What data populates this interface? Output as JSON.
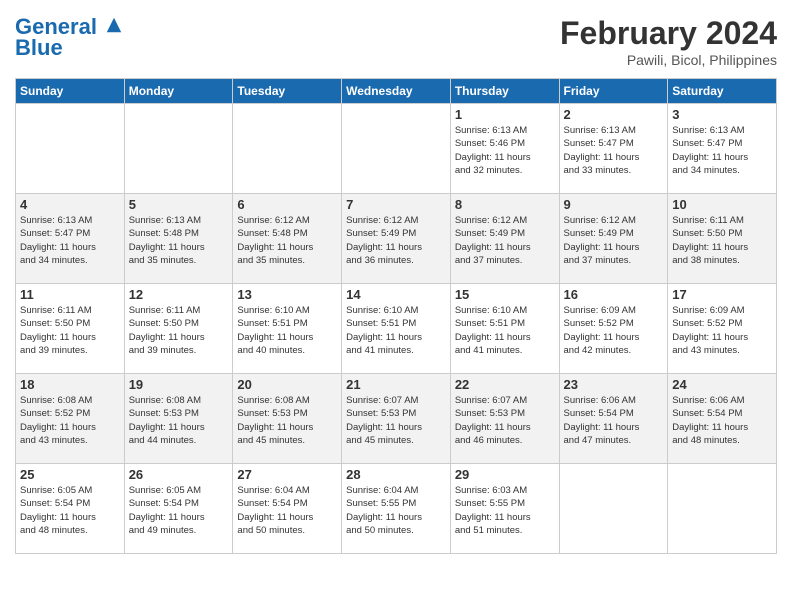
{
  "header": {
    "logo_line1": "General",
    "logo_line2": "Blue",
    "month_year": "February 2024",
    "location": "Pawili, Bicol, Philippines"
  },
  "calendar": {
    "days_of_week": [
      "Sunday",
      "Monday",
      "Tuesday",
      "Wednesday",
      "Thursday",
      "Friday",
      "Saturday"
    ],
    "weeks": [
      [
        {
          "day": "",
          "info": ""
        },
        {
          "day": "",
          "info": ""
        },
        {
          "day": "",
          "info": ""
        },
        {
          "day": "",
          "info": ""
        },
        {
          "day": "1",
          "info": "Sunrise: 6:13 AM\nSunset: 5:46 PM\nDaylight: 11 hours\nand 32 minutes."
        },
        {
          "day": "2",
          "info": "Sunrise: 6:13 AM\nSunset: 5:47 PM\nDaylight: 11 hours\nand 33 minutes."
        },
        {
          "day": "3",
          "info": "Sunrise: 6:13 AM\nSunset: 5:47 PM\nDaylight: 11 hours\nand 34 minutes."
        }
      ],
      [
        {
          "day": "4",
          "info": "Sunrise: 6:13 AM\nSunset: 5:47 PM\nDaylight: 11 hours\nand 34 minutes."
        },
        {
          "day": "5",
          "info": "Sunrise: 6:13 AM\nSunset: 5:48 PM\nDaylight: 11 hours\nand 35 minutes."
        },
        {
          "day": "6",
          "info": "Sunrise: 6:12 AM\nSunset: 5:48 PM\nDaylight: 11 hours\nand 35 minutes."
        },
        {
          "day": "7",
          "info": "Sunrise: 6:12 AM\nSunset: 5:49 PM\nDaylight: 11 hours\nand 36 minutes."
        },
        {
          "day": "8",
          "info": "Sunrise: 6:12 AM\nSunset: 5:49 PM\nDaylight: 11 hours\nand 37 minutes."
        },
        {
          "day": "9",
          "info": "Sunrise: 6:12 AM\nSunset: 5:49 PM\nDaylight: 11 hours\nand 37 minutes."
        },
        {
          "day": "10",
          "info": "Sunrise: 6:11 AM\nSunset: 5:50 PM\nDaylight: 11 hours\nand 38 minutes."
        }
      ],
      [
        {
          "day": "11",
          "info": "Sunrise: 6:11 AM\nSunset: 5:50 PM\nDaylight: 11 hours\nand 39 minutes."
        },
        {
          "day": "12",
          "info": "Sunrise: 6:11 AM\nSunset: 5:50 PM\nDaylight: 11 hours\nand 39 minutes."
        },
        {
          "day": "13",
          "info": "Sunrise: 6:10 AM\nSunset: 5:51 PM\nDaylight: 11 hours\nand 40 minutes."
        },
        {
          "day": "14",
          "info": "Sunrise: 6:10 AM\nSunset: 5:51 PM\nDaylight: 11 hours\nand 41 minutes."
        },
        {
          "day": "15",
          "info": "Sunrise: 6:10 AM\nSunset: 5:51 PM\nDaylight: 11 hours\nand 41 minutes."
        },
        {
          "day": "16",
          "info": "Sunrise: 6:09 AM\nSunset: 5:52 PM\nDaylight: 11 hours\nand 42 minutes."
        },
        {
          "day": "17",
          "info": "Sunrise: 6:09 AM\nSunset: 5:52 PM\nDaylight: 11 hours\nand 43 minutes."
        }
      ],
      [
        {
          "day": "18",
          "info": "Sunrise: 6:08 AM\nSunset: 5:52 PM\nDaylight: 11 hours\nand 43 minutes."
        },
        {
          "day": "19",
          "info": "Sunrise: 6:08 AM\nSunset: 5:53 PM\nDaylight: 11 hours\nand 44 minutes."
        },
        {
          "day": "20",
          "info": "Sunrise: 6:08 AM\nSunset: 5:53 PM\nDaylight: 11 hours\nand 45 minutes."
        },
        {
          "day": "21",
          "info": "Sunrise: 6:07 AM\nSunset: 5:53 PM\nDaylight: 11 hours\nand 45 minutes."
        },
        {
          "day": "22",
          "info": "Sunrise: 6:07 AM\nSunset: 5:53 PM\nDaylight: 11 hours\nand 46 minutes."
        },
        {
          "day": "23",
          "info": "Sunrise: 6:06 AM\nSunset: 5:54 PM\nDaylight: 11 hours\nand 47 minutes."
        },
        {
          "day": "24",
          "info": "Sunrise: 6:06 AM\nSunset: 5:54 PM\nDaylight: 11 hours\nand 48 minutes."
        }
      ],
      [
        {
          "day": "25",
          "info": "Sunrise: 6:05 AM\nSunset: 5:54 PM\nDaylight: 11 hours\nand 48 minutes."
        },
        {
          "day": "26",
          "info": "Sunrise: 6:05 AM\nSunset: 5:54 PM\nDaylight: 11 hours\nand 49 minutes."
        },
        {
          "day": "27",
          "info": "Sunrise: 6:04 AM\nSunset: 5:54 PM\nDaylight: 11 hours\nand 50 minutes."
        },
        {
          "day": "28",
          "info": "Sunrise: 6:04 AM\nSunset: 5:55 PM\nDaylight: 11 hours\nand 50 minutes."
        },
        {
          "day": "29",
          "info": "Sunrise: 6:03 AM\nSunset: 5:55 PM\nDaylight: 11 hours\nand 51 minutes."
        },
        {
          "day": "",
          "info": ""
        },
        {
          "day": "",
          "info": ""
        }
      ]
    ]
  }
}
